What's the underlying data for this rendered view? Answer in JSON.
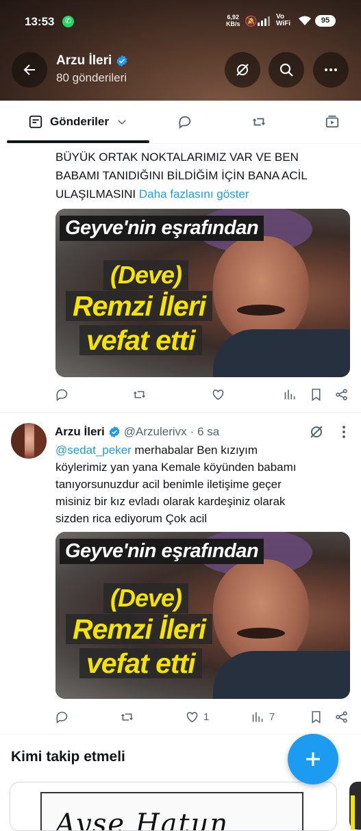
{
  "status_bar": {
    "time": "13:53",
    "net_speed_value": "6,92",
    "net_speed_unit": "KB/s",
    "vowifi_top": "Vo",
    "vowifi_bottom": "WiFi",
    "battery": "95"
  },
  "header": {
    "name": "Arzu İleri",
    "posts_count": "80 gönderileri"
  },
  "tabs": {
    "posts_label": "Gönderiler"
  },
  "tweet1": {
    "text_lines": [
      "BÜYÜK ORTAK NOKTALARIMIZ VAR VE BEN",
      "BABAMI TANIDIĞINI BİLDİĞİM İÇİN BANA ACİL",
      "ULAŞILMASINI"
    ],
    "show_more": "Daha fazlasını göster",
    "image": {
      "caption_top": "Geyve'nin eşrafından",
      "caption_mid": "(Deve)",
      "caption_name": "Remzi İleri",
      "caption_bottom": "vefat etti"
    }
  },
  "tweet2": {
    "name": "Arzu İleri",
    "handle": "@Arzulerivx",
    "time": "· 6 sa",
    "mention": "@sedat_peker",
    "text_lines": [
      " merhabalar Ben kızıyım",
      "köylerimiz yan yana Kemale köyünden babamı",
      "tanıyorsunuzdur acil benimle iletişime geçer",
      "misiniz bir kız evladı olarak kardeşiniz olarak",
      "sizden rica ediyorum Çok acil"
    ],
    "image": {
      "caption_top": "Geyve'nin eşrafından",
      "caption_mid": "(Deve)",
      "caption_name": "Remzi İleri",
      "caption_bottom": "vefat etti"
    },
    "likes": "1",
    "views": "7"
  },
  "who_to_follow": {
    "title": "Kimi takip etmeli",
    "card_text": "Ayşe Hatun"
  },
  "colors": {
    "accent": "#1d9bf0",
    "muted": "#536471",
    "caption_yellow": "#f5e400"
  }
}
